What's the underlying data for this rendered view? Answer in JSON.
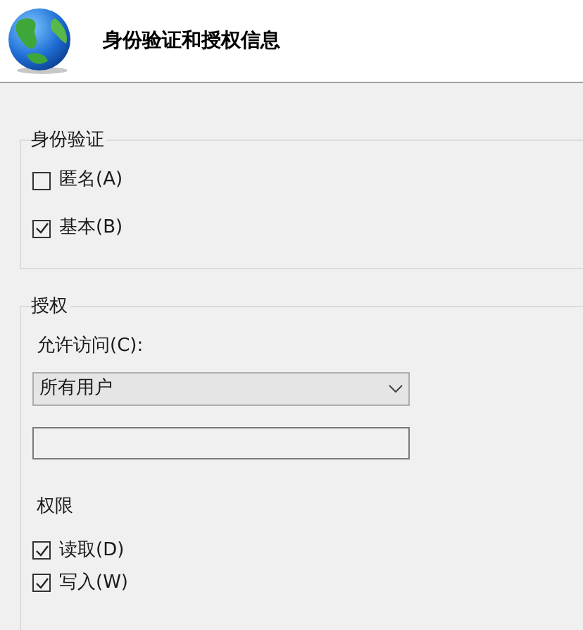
{
  "header": {
    "title": "身份验证和授权信息"
  },
  "authentication": {
    "legend": "身份验证",
    "options": [
      {
        "label": "匿名(A)",
        "checked": false
      },
      {
        "label": "基本(B)",
        "checked": true
      }
    ]
  },
  "authorization": {
    "legend": "授权",
    "access_label": "允许访问(C):",
    "access_select": {
      "value": "所有用户"
    },
    "permissions_label": "权限",
    "permissions": [
      {
        "label": "读取(D)",
        "checked": true
      },
      {
        "label": "写入(W)",
        "checked": true
      }
    ]
  }
}
